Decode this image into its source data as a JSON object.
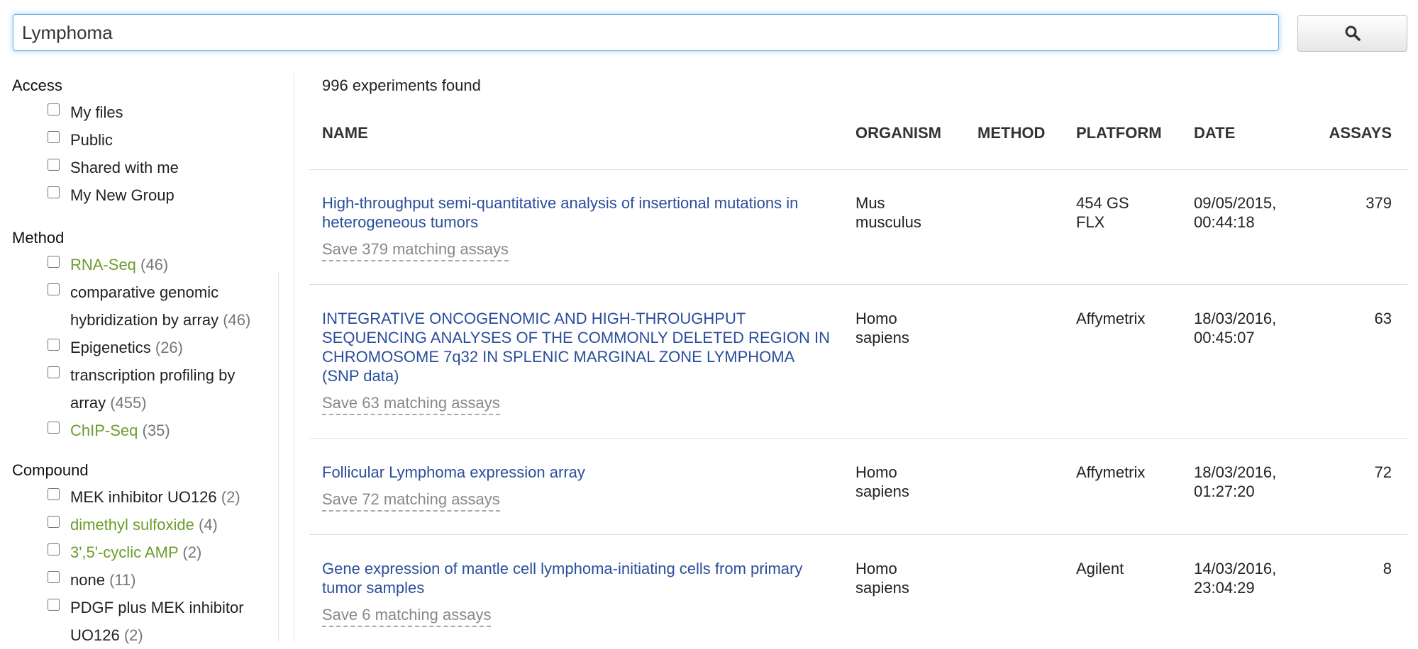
{
  "search": {
    "value": "Lymphoma",
    "button_icon": "search-icon"
  },
  "sidebar": {
    "access": {
      "heading": "Access",
      "items": [
        {
          "label": "My files"
        },
        {
          "label": "Public"
        },
        {
          "label": "Shared with me"
        },
        {
          "label": "My New Group"
        }
      ]
    },
    "method": {
      "heading": "Method",
      "items": [
        {
          "label": "RNA-Seq",
          "count": "(46)"
        },
        {
          "label": "comparative genomic hybridization by array",
          "count": "(46)"
        },
        {
          "label": "Epigenetics",
          "count": "(26)"
        },
        {
          "label": "transcription profiling by array",
          "count": "(455)"
        },
        {
          "label": "ChIP-Seq",
          "count": "(35)"
        }
      ]
    },
    "compound": {
      "heading": "Compound",
      "items": [
        {
          "label": "MEK inhibitor UO126",
          "count": "(2)"
        },
        {
          "label": "dimethyl sulfoxide",
          "count": "(4)"
        },
        {
          "label": "3',5'-cyclic AMP",
          "count": "(2)"
        },
        {
          "label": "none",
          "count": "(11)"
        },
        {
          "label": "PDGF plus MEK inhibitor UO126",
          "count": "(2)"
        }
      ]
    }
  },
  "results": {
    "count_text": "996 experiments found",
    "columns": [
      "NAME",
      "ORGANISM",
      "METHOD",
      "PLATFORM",
      "DATE",
      "ASSAYS"
    ],
    "rows": [
      {
        "name": "High-throughput semi-quantitative analysis of insertional mutations in heterogeneous tumors",
        "save": "Save 379 matching assays",
        "organism": "Mus musculus",
        "method": "",
        "platform": "454 GS FLX",
        "date": "09/05/2015, 00:44:18",
        "assays": "379"
      },
      {
        "name": "INTEGRATIVE ONCOGENOMIC AND HIGH-THROUGHPUT SEQUENCING ANALYSES OF THE COMMONLY DELETED REGION IN CHROMOSOME 7q32 IN SPLENIC MARGINAL ZONE LYMPHOMA (SNP data)",
        "save": "Save 63 matching assays",
        "organism": "Homo sapiens",
        "method": "",
        "platform": "Affymetrix",
        "date": "18/03/2016, 00:45:07",
        "assays": "63"
      },
      {
        "name": "Follicular Lymphoma expression array",
        "save": "Save 72 matching assays",
        "organism": "Homo sapiens",
        "method": "",
        "platform": "Affymetrix",
        "date": "18/03/2016, 01:27:20",
        "assays": "72"
      },
      {
        "name": "Gene expression of mantle cell lymphoma-initiating cells from primary tumor samples",
        "save": "Save 6 matching assays",
        "organism": "Homo sapiens",
        "method": "",
        "platform": "Agilent",
        "date": "14/03/2016, 23:04:29",
        "assays": "8"
      }
    ]
  },
  "colors": {
    "link": "#2a4e9c",
    "facet_green": "#6b9d2c",
    "count_gray": "#777777",
    "focus_blue": "#66afe9"
  }
}
